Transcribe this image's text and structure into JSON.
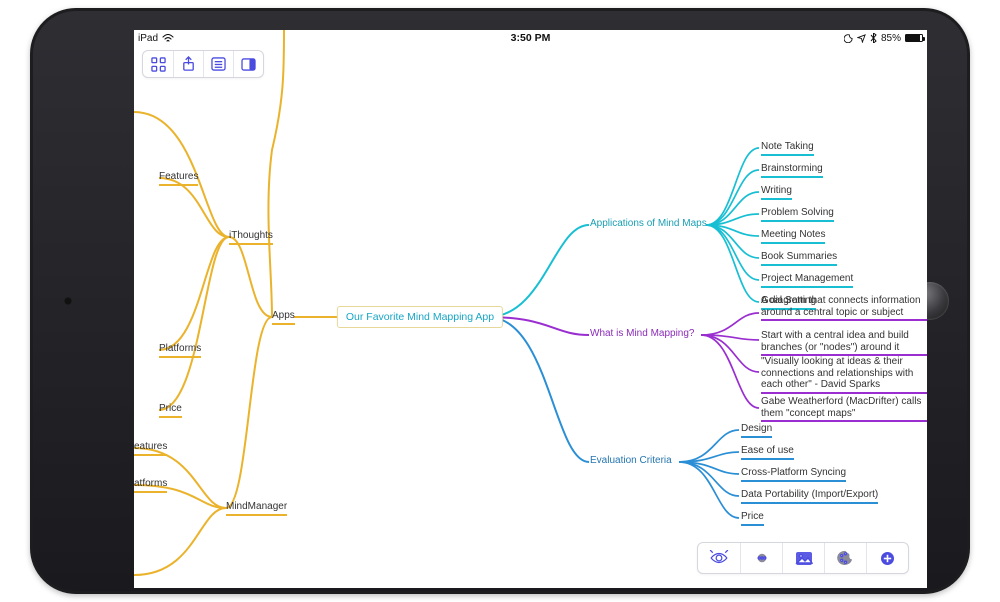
{
  "status": {
    "device": "iPad",
    "time": "3:50 PM",
    "battery_pct": "85%",
    "battery_fill": 85
  },
  "toolbar_top": {
    "grid": "grid-icon",
    "share": "share-icon",
    "list": "list-icon",
    "panel": "panel-icon"
  },
  "toolbar_bottom": {
    "focus": "focus-icon",
    "more": "more-icon",
    "image": "image-icon",
    "color": "palette-icon",
    "add": "add-icon"
  },
  "map": {
    "center": "Our Favorite Mind Mapping App",
    "left": {
      "apps": "Apps",
      "ithoughts": "iThoughts",
      "features1": "Features",
      "platforms1": "Platforms",
      "price1": "Price",
      "features2": "eatures",
      "platforms2": "atforms",
      "mindmanager": "MindManager"
    },
    "right": {
      "applications": {
        "label": "Applications of Mind Maps",
        "items": [
          "Note Taking",
          "Brainstorming",
          "Writing",
          "Problem Solving",
          "Meeting Notes",
          "Book Summaries",
          "Project Management",
          "Goal Setting"
        ]
      },
      "whatis": {
        "label": "What is Mind Mapping?",
        "items": [
          "A diagram that connects information around a central topic or subject",
          "Start with a central idea and build branches (or \"nodes\") around it",
          "\"Visually looking at ideas & their connections and relationships with each other\" - David Sparks",
          "Gabe Weatherford (MacDrifter) calls them \"concept maps\""
        ]
      },
      "criteria": {
        "label": "Evaluation Criteria",
        "items": [
          "Design",
          "Ease of use",
          "Cross-Platform Syncing",
          "Data Portability (Import/Export)",
          "Price"
        ]
      }
    }
  },
  "colors": {
    "teal": "#18bfd3",
    "purple": "#9a2ed0",
    "blue": "#2b8fd6",
    "orange": "#eab32b"
  }
}
